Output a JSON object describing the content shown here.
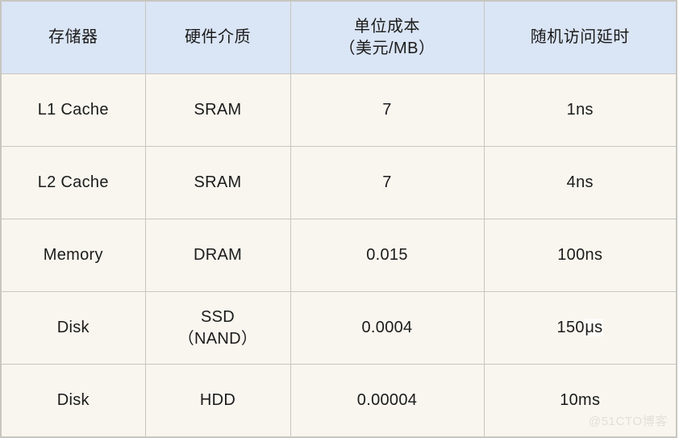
{
  "table": {
    "columns": [
      {
        "label": "存储器"
      },
      {
        "label": "硬件介质"
      },
      {
        "label_line1": "单位成本",
        "label_line2": "（美元/MB）"
      },
      {
        "label": "随机访问延时"
      }
    ],
    "rows": [
      {
        "storage": "L1 Cache",
        "medium": "SRAM",
        "cost": "7",
        "latency_value": "1",
        "latency_unit": "ns"
      },
      {
        "storage": "L2 Cache",
        "medium": "SRAM",
        "cost": "7",
        "latency_value": "4",
        "latency_unit": "ns"
      },
      {
        "storage": "Memory",
        "medium": "DRAM",
        "cost": "0.015",
        "latency_value": "100",
        "latency_unit": "ns"
      },
      {
        "storage": "Disk",
        "medium_line1": "SSD",
        "medium_line2": "（NAND）",
        "cost": "0.0004",
        "latency_value": "150",
        "latency_unit": "μs"
      },
      {
        "storage": "Disk",
        "medium": "HDD",
        "cost": "0.00004",
        "latency_value": "10",
        "latency_unit": "ms"
      }
    ]
  },
  "watermark": {
    "text": "@51CTO博客"
  },
  "colors": {
    "header_background": "#dae5f5",
    "body_background": "#f8f6ef",
    "border": "#c8c6c0",
    "text": "#1b1b1b",
    "watermark": "#e2e0d9"
  }
}
